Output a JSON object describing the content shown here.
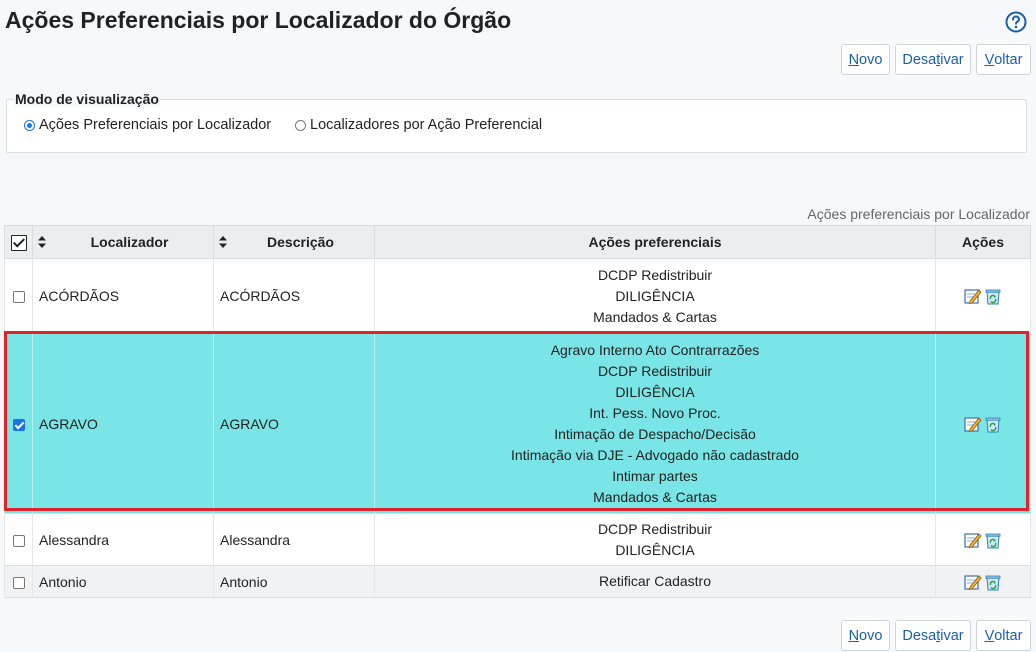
{
  "page": {
    "title": "Ações Preferenciais por Localizador do Órgão"
  },
  "buttons": {
    "new_prefix": "",
    "new_hot": "N",
    "new_rest": "ovo",
    "deactivate_prefix": "Desa",
    "deactivate_hot": "t",
    "deactivate_rest": "ivar",
    "back_prefix": "",
    "back_hot": "V",
    "back_rest": "oltar"
  },
  "view_mode": {
    "legend": "Modo de visualização",
    "options": [
      {
        "label": "Ações Preferenciais por Localizador",
        "selected": true
      },
      {
        "label": "Localizadores por Ação Preferencial",
        "selected": false
      }
    ]
  },
  "table": {
    "caption": "Ações preferenciais por Localizador",
    "headers": {
      "localizador": "Localizador",
      "descricao": "Descrição",
      "acoes_pref": "Ações preferenciais",
      "acoes": "Ações"
    },
    "rows": [
      {
        "checked": false,
        "localizador": "ACÓRDÃOS",
        "descricao": "ACÓRDÃOS",
        "acoes": [
          "DCDP Redistribuir",
          "DILIGÊNCIA",
          "Mandados & Cartas"
        ]
      },
      {
        "checked": true,
        "localizador": "AGRAVO",
        "descricao": "AGRAVO",
        "acoes": [
          "Agravo Interno Ato Contrarrazões",
          "DCDP Redistribuir",
          "DILIGÊNCIA",
          "Int. Pess. Novo Proc.",
          "Intimação de Despacho/Decisão",
          "Intimação via DJE - Advogado não cadastrado",
          "Intimar partes",
          "Mandados & Cartas"
        ]
      },
      {
        "checked": false,
        "localizador": "Alessandra",
        "descricao": "Alessandra",
        "acoes": [
          "DCDP Redistribuir",
          "DILIGÊNCIA"
        ]
      },
      {
        "checked": false,
        "localizador": "Antonio",
        "descricao": "Antonio",
        "acoes": [
          "Retificar Cadastro"
        ]
      }
    ]
  },
  "icons": {
    "help": "help-icon",
    "edit": "edit-icon",
    "delete": "recycle-bin-icon",
    "sort": "sort-icon"
  },
  "colors": {
    "selected_row": "#79e5e7",
    "highlight_border": "#e0232a",
    "link": "#1a5fa8"
  }
}
